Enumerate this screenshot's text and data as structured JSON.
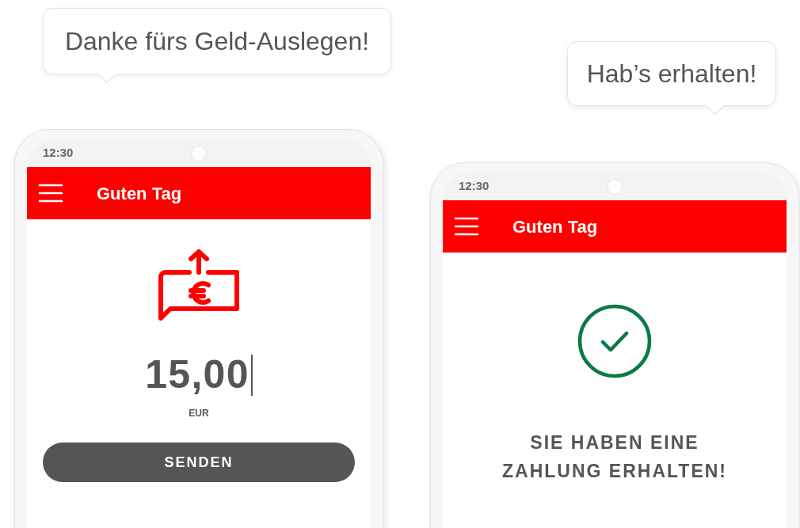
{
  "bubbles": [
    {
      "text": "Danke fürs Geld-Auslegen!"
    },
    {
      "text": "Hab’s erhalten!"
    }
  ],
  "phones": [
    {
      "kind": "send",
      "time": "12:30",
      "title": "Guten Tag",
      "amount": "15,00",
      "currency": "EUR",
      "button": "SENDEN"
    },
    {
      "kind": "received",
      "time": "12:30",
      "title": "Guten Tag",
      "message": "SIE HABEN EINE ZAHLUNG ERHALTEN!"
    }
  ]
}
